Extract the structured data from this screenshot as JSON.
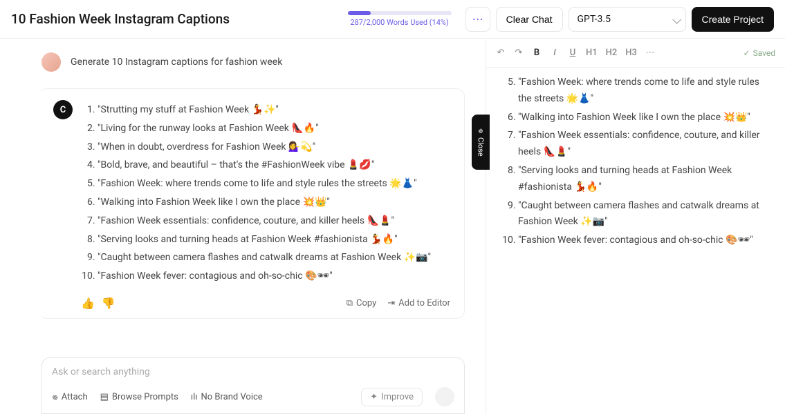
{
  "header": {
    "title": "10 Fashion Week Instagram Captions",
    "words_used": "287/2,000 Words Used (14%)",
    "clear_chat": "Clear Chat",
    "model": "GPT-3.5",
    "create_project": "Create Project"
  },
  "chat": {
    "user_prompt": "Generate 10 Instagram captions for fashion week",
    "bot_avatar": "C",
    "captions": [
      "\"Strutting my stuff at Fashion Week 💃✨\"",
      "\"Living for the runway looks at Fashion Week 👠🔥\"",
      "\"When in doubt, overdress for Fashion Week 💁‍♀️💫\"",
      "\"Bold, brave, and beautiful – that's the #FashionWeek vibe 💄💋\"",
      "\"Fashion Week: where trends come to life and style rules the streets 🌟👗\"",
      "\"Walking into Fashion Week like I own the place 💥👑\"",
      "\"Fashion Week essentials: confidence, couture, and killer heels 👠💄\"",
      "\"Serving looks and turning heads at Fashion Week #fashionista 💃🔥\"",
      "\"Caught between camera flashes and catwalk dreams at Fashion Week ✨📷\"",
      "\"Fashion Week fever: contagious and oh-so-chic 🎨🕶\""
    ],
    "actions": {
      "copy": "Copy",
      "add_to_editor": "Add to Editor"
    }
  },
  "input": {
    "placeholder": "Ask or search anything",
    "attach": "Attach",
    "browse_prompts": "Browse Prompts",
    "no_brand_voice": "No Brand Voice",
    "improve": "Improve"
  },
  "editor": {
    "toolbar": {
      "h1": "H1",
      "h2": "H2",
      "h3": "H3",
      "saved": "Saved"
    },
    "list_start": 5,
    "items": [
      "\"Fashion Week: where trends come to life and style rules the streets 🌟👗\"",
      "\"Walking into Fashion Week like I own the place 💥👑\"",
      "\"Fashion Week essentials: confidence, couture, and killer heels 👠💄\"",
      "\"Serving looks and turning heads at Fashion Week #fashionista 💃🔥\"",
      "\"Caught between camera flashes and catwalk dreams at Fashion Week ✨📷\"",
      "\"Fashion Week fever: contagious and oh-so-chic 🎨🕶\""
    ]
  },
  "close_tab": "Close"
}
